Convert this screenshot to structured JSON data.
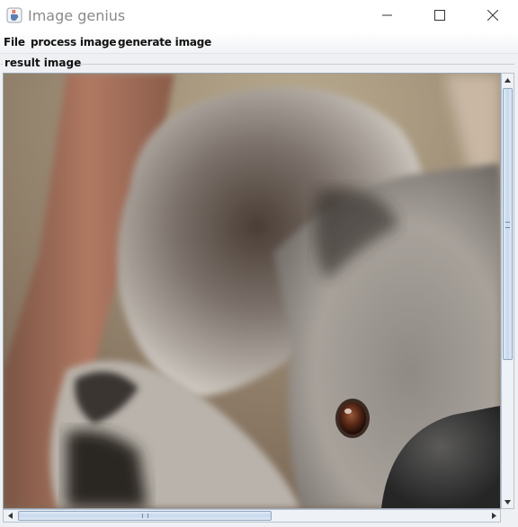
{
  "window": {
    "title": "Image genius",
    "icons": {
      "app": "java-coffee-cup-icon",
      "minimize": "minimize-icon",
      "maximize": "maximize-icon",
      "close": "close-icon"
    }
  },
  "menu": {
    "items": [
      "File",
      "process image",
      "generate image"
    ]
  },
  "panel": {
    "title": "result image",
    "image_subject": "koala close-up",
    "scroll": {
      "vertical_thumb_fraction": 0.65,
      "vertical_position": 0.0,
      "horizontal_thumb_fraction": 0.55,
      "horizontal_position": 0.0
    }
  },
  "colors": {
    "selection_thumb": "#c8d8ec",
    "panel_bg": "#eef0f3"
  }
}
